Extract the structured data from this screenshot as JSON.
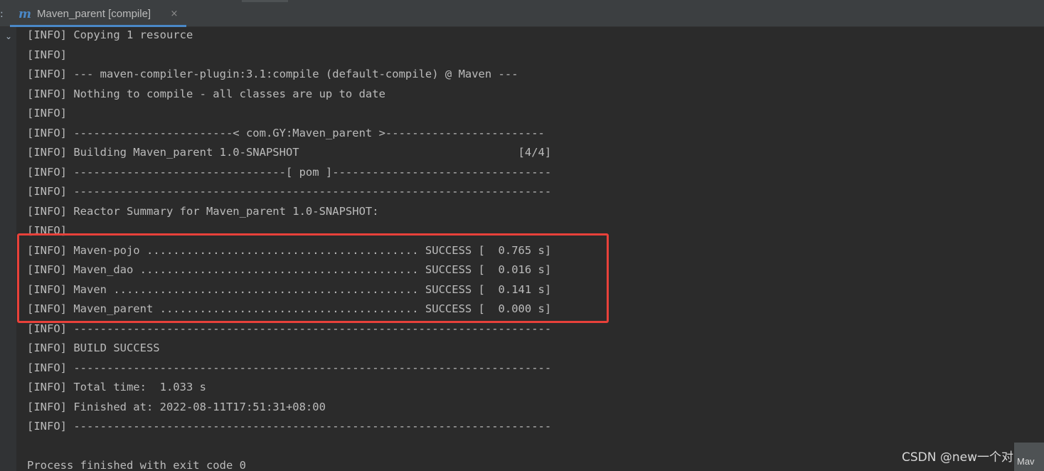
{
  "window": {
    "tab_label": "Maven_parent [compile]",
    "tab_icon_glyph": "m",
    "tab_close_glyph": "×",
    "strip_colon": ":",
    "chevron_glyph": "⌄"
  },
  "colors": {
    "background": "#2b2b2b",
    "text": "#bbbbbb",
    "accent": "#4a88c7",
    "highlight": "#e8413a"
  },
  "console_lines": [
    "[INFO] Copying 1 resource",
    "[INFO]",
    "[INFO] --- maven-compiler-plugin:3.1:compile (default-compile) @ Maven ---",
    "[INFO] Nothing to compile - all classes are up to date",
    "[INFO]",
    "[INFO] ------------------------< com.GY:Maven_parent >------------------------",
    "[INFO] Building Maven_parent 1.0-SNAPSHOT                                 [4/4]",
    "[INFO] --------------------------------[ pom ]---------------------------------",
    "[INFO] ------------------------------------------------------------------------",
    "[INFO] Reactor Summary for Maven_parent 1.0-SNAPSHOT:",
    "[INFO]",
    "[INFO] Maven-pojo ......................................... SUCCESS [  0.765 s]",
    "[INFO] Maven_dao .......................................... SUCCESS [  0.016 s]",
    "[INFO] Maven .............................................. SUCCESS [  0.141 s]",
    "[INFO] Maven_parent ....................................... SUCCESS [  0.000 s]",
    "[INFO] ------------------------------------------------------------------------",
    "[INFO] BUILD SUCCESS",
    "[INFO] ------------------------------------------------------------------------",
    "[INFO] Total time:  1.033 s",
    "[INFO] Finished at: 2022-08-11T17:51:31+08:00",
    "[INFO] ------------------------------------------------------------------------",
    "",
    "Process finished with exit code 0"
  ],
  "watermark": "CSDN @new一个对象",
  "corner_tab_label": "Mav"
}
